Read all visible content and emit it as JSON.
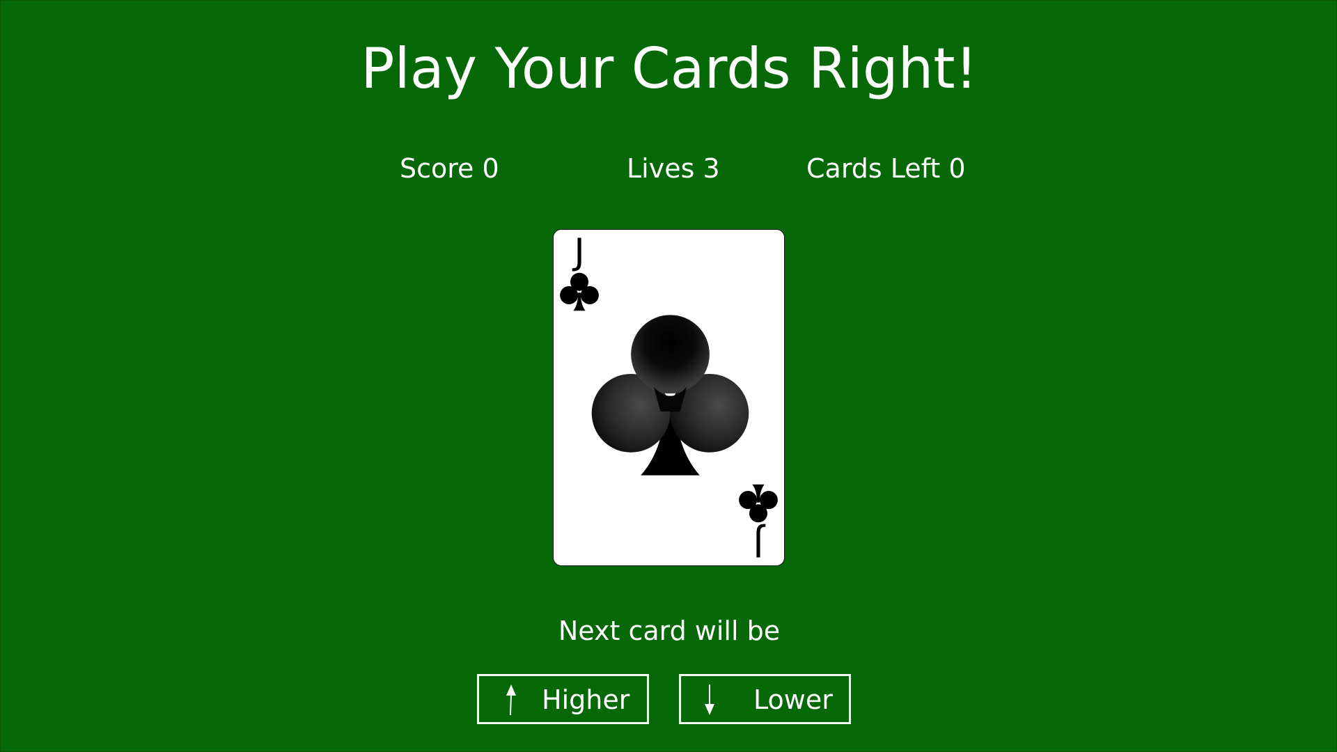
{
  "title": "Play Your Cards Right!",
  "stats": {
    "score_label": "Score 0",
    "lives_label": "Lives 3",
    "cards_left_label": "Cards Left 0",
    "score": 0,
    "lives": 3,
    "cards_left": 0
  },
  "current_card": {
    "rank": "J",
    "suit": "clubs",
    "suit_icon": "club-icon",
    "color": "#000000"
  },
  "prompt": "Next card will be",
  "buttons": {
    "higher_label": "Higher",
    "higher_icon": "arrow-up-icon",
    "lower_label": "Lower",
    "lower_icon": "arrow-down-icon"
  },
  "colors": {
    "background": "#076807",
    "text": "#ffffff",
    "card_face": "#ffffff",
    "suit": "#000000"
  }
}
